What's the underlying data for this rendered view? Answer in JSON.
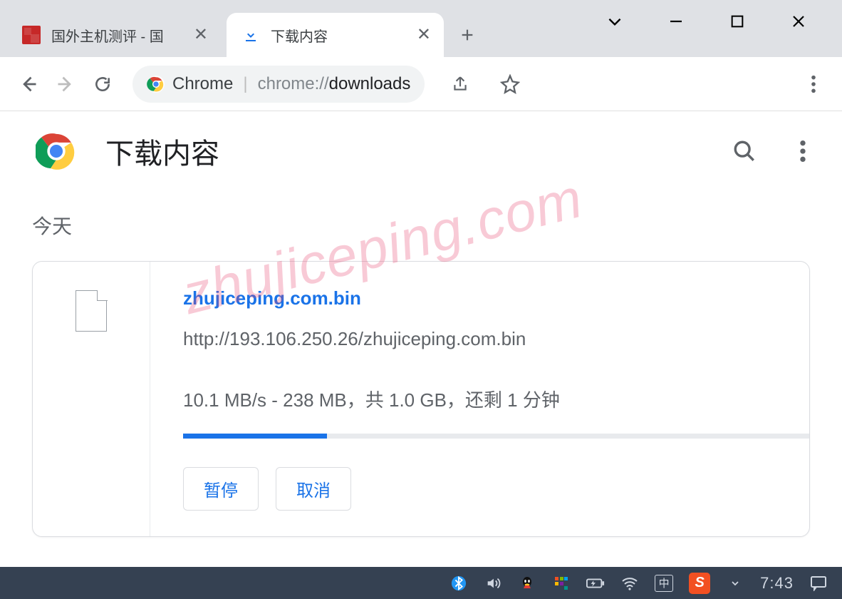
{
  "tabs": {
    "inactive": {
      "title": "国外主机测评 - 国"
    },
    "active": {
      "title": "下载内容"
    }
  },
  "omnibox": {
    "chip_label": "Chrome",
    "url_prefix": "chrome://",
    "url_path": "downloads"
  },
  "page": {
    "title": "下载内容",
    "date_heading": "今天"
  },
  "download": {
    "filename": "zhujiceping.com.bin",
    "source_url": "http://193.106.250.26/zhujiceping.com.bin",
    "status_line": "10.1 MB/s - 238 MB，共 1.0 GB，还剩 1 分钟",
    "button_pause": "暂停",
    "button_cancel": "取消"
  },
  "watermark": "zhujiceping.com",
  "taskbar": {
    "ime": "中",
    "clock": "7:43"
  }
}
